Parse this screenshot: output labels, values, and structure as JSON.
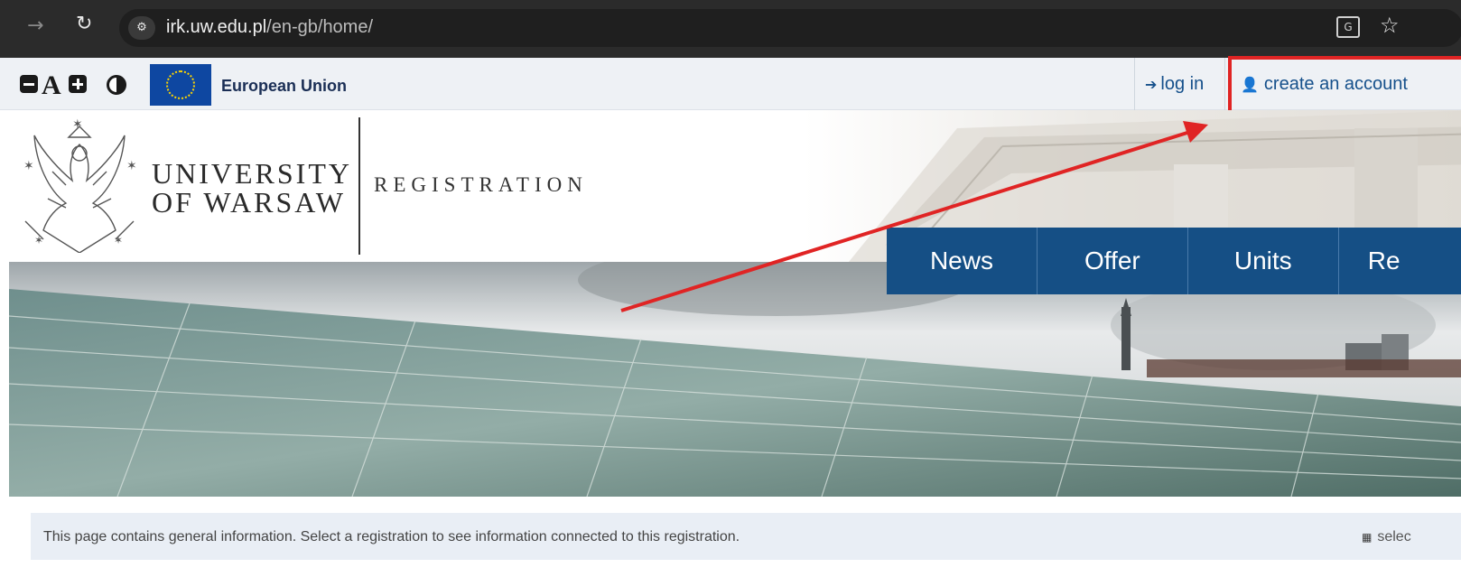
{
  "browser": {
    "url_host": "irk.uw.edu.pl",
    "url_path": "/en-gb/home/",
    "icons": {
      "back": "back-arrow-icon",
      "reload": "reload-icon",
      "site_info": "site-info-icon",
      "translate": "translate-icon",
      "bookmark": "star-icon"
    }
  },
  "topbar": {
    "accessibility": {
      "font_label": "A"
    },
    "eu_label": "European Union",
    "login_label": "log in",
    "create_account_label": "create an account"
  },
  "header": {
    "university_line1": "UNIVERSITY",
    "university_line2": "OF WARSAW",
    "section_title": "REGISTRATION"
  },
  "nav": {
    "items": [
      {
        "label": "News"
      },
      {
        "label": "Offer"
      },
      {
        "label": "Units"
      },
      {
        "label": "Re"
      }
    ]
  },
  "info": {
    "text": "This page contains general information. Select a registration to see information connected to this registration.",
    "select_label": "selec"
  },
  "colors": {
    "nav_bg": "#154f85",
    "link": "#15508b",
    "highlight": "#e02424",
    "eu_blue": "#0e47a1"
  }
}
